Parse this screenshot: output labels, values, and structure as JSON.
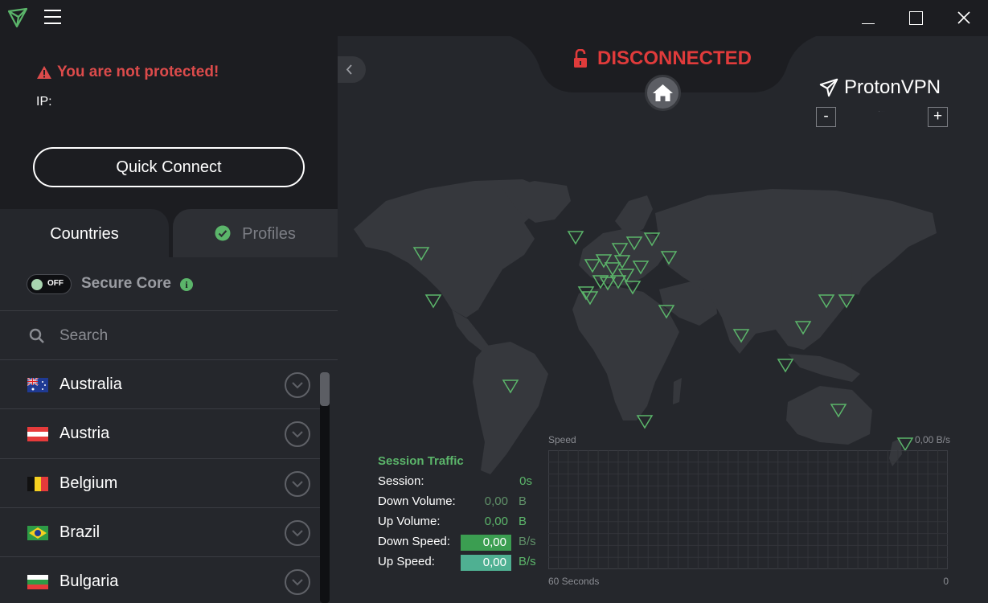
{
  "app": {
    "name": "ProtonVPN"
  },
  "status_panel": {
    "warning": "You are not protected!",
    "ip_label": "IP:",
    "quick_connect_label": "Quick Connect"
  },
  "tabs": {
    "countries": "Countries",
    "profiles": "Profiles"
  },
  "secure_core": {
    "toggle_state": "OFF",
    "label": "Secure Core"
  },
  "search": {
    "placeholder": "Search"
  },
  "countries": [
    {
      "name": "Australia",
      "flag": "flag-australia"
    },
    {
      "name": "Austria",
      "flag": "flag-austria"
    },
    {
      "name": "Belgium",
      "flag": "flag-belgium"
    },
    {
      "name": "Brazil",
      "flag": "flag-brazil"
    },
    {
      "name": "Bulgaria",
      "flag": "flag-bulgaria"
    }
  ],
  "connection": {
    "status": "DISCONNECTED",
    "status_color": "#e03b3b"
  },
  "zoom": {
    "out_label": "-",
    "in_label": "+"
  },
  "session_traffic": {
    "title": "Session Traffic",
    "session_label": "Session:",
    "session_value": "0s",
    "down_volume_label": "Down Volume:",
    "down_volume_value": "0,00",
    "down_volume_unit": "B",
    "up_volume_label": "Up Volume:",
    "up_volume_value": "0,00",
    "up_volume_unit": "B",
    "down_speed_label": "Down Speed:",
    "down_speed_value": "0,00",
    "down_speed_unit": "B/s",
    "up_speed_label": "Up Speed:",
    "up_speed_value": "0,00",
    "up_speed_unit": "B/s"
  },
  "speed_graph": {
    "label": "Speed",
    "value": "0,00  B/s",
    "time_label": "60 Seconds",
    "end_label": "0"
  },
  "colors": {
    "accent_green": "#5bb56a",
    "danger_red": "#dc4b4b",
    "background": "#1c1d21",
    "panel": "#25272c"
  }
}
